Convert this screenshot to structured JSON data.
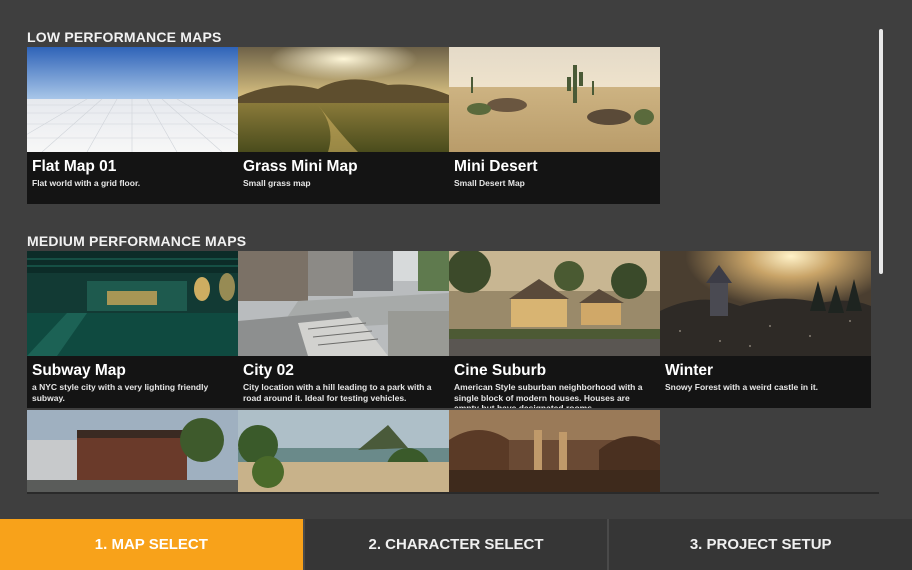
{
  "sections": {
    "low": {
      "title": "LOW PERFORMANCE MAPS",
      "maps": [
        {
          "name": "Flat Map 01",
          "desc": "Flat world with a grid floor."
        },
        {
          "name": "Grass Mini Map",
          "desc": "Small grass map"
        },
        {
          "name": "Mini Desert",
          "desc": "Small Desert Map"
        }
      ]
    },
    "medium": {
      "title": "MEDIUM PERFORMANCE MAPS",
      "maps": [
        {
          "name": "Subway Map",
          "desc": "a NYC style city with a very lighting friendly subway."
        },
        {
          "name": "City 02",
          "desc": "City location with a hill leading to a park with a road around it.  Ideal for testing vehicles."
        },
        {
          "name": "Cine Suburb",
          "desc": "American Style suburban neighborhood with a single block of modern houses.  Houses are empty but have designated rooms."
        },
        {
          "name": "Winter",
          "desc": "Snowy Forest with a weird castle in it."
        }
      ]
    }
  },
  "tabs": [
    {
      "label": "1. MAP SELECT",
      "active": true
    },
    {
      "label": "2. CHARACTER SELECT",
      "active": false
    },
    {
      "label": "3. PROJECT SETUP",
      "active": false
    }
  ],
  "colors": {
    "background": "#3f3f3f",
    "card": "#141414",
    "accent": "#f8a21a",
    "tab": "#363636"
  }
}
